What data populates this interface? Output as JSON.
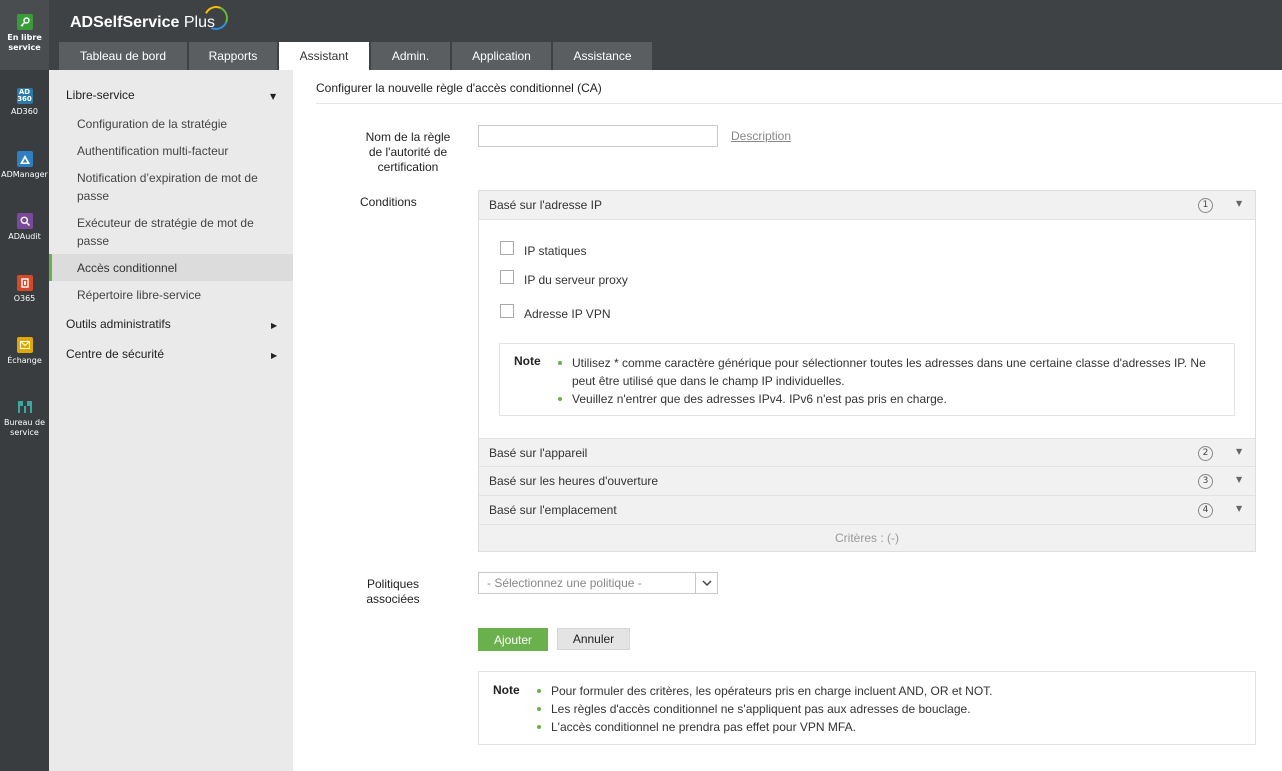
{
  "rail": [
    {
      "label": "En libre service",
      "icon": "key-icon",
      "color": "#3a9b3a"
    },
    {
      "label": "AD360",
      "icon": "ad360-icon",
      "color": "#2b7aa8"
    },
    {
      "label": "ADManager",
      "icon": "admanager-icon",
      "color": "#2d7fc1"
    },
    {
      "label": "ADAudit",
      "icon": "adaudit-icon",
      "color": "#7a4a9a"
    },
    {
      "label": "O365",
      "icon": "o365-icon",
      "color": "#d64a2a"
    },
    {
      "label": "Échange",
      "icon": "exchange-icon",
      "color": "#e0a800"
    },
    {
      "label": "Bureau de service",
      "icon": "servicedesk-icon",
      "color": "#3aa8a0"
    }
  ],
  "header": {
    "brand": "ADSelfService",
    "brand_plus": "Plus",
    "tabs": [
      "Tableau de bord",
      "Rapports",
      "Assistant",
      "Admin.",
      "Application",
      "Assistance"
    ],
    "active_tab": "Assistant"
  },
  "sidebar": {
    "group1": "Libre-service",
    "items": [
      "Configuration de la stratégie",
      "Authentification multi-facteur",
      "Notification d’expiration de mot de passe",
      "Exécuteur de stratégie de mot de passe",
      "Accès conditionnel",
      "Répertoire libre-service"
    ],
    "active_item": "Accès conditionnel",
    "group2": "Outils administratifs",
    "group3": "Centre de sécurité"
  },
  "main": {
    "title": "Configurer la nouvelle règle d'accès conditionnel (CA)",
    "rule_name_label": "Nom de la règle de l'autorité de certification",
    "rule_name_value": "",
    "description_link": "Description",
    "conditions_label": "Conditions",
    "accordion": [
      {
        "label": "Basé sur l'adresse IP",
        "num": "1"
      },
      {
        "label": "Basé sur l'appareil",
        "num": "2"
      },
      {
        "label": "Basé sur les heures d'ouverture",
        "num": "3"
      },
      {
        "label": "Basé sur l'emplacement",
        "num": "4"
      }
    ],
    "ip_options": [
      "IP statiques",
      "IP du serveur proxy",
      "Adresse IP VPN"
    ],
    "ip_note_title": "Note",
    "ip_notes": [
      "Utilisez * comme caractère générique pour sélectionner toutes les adresses dans une certaine classe d'adresses IP. Ne peut être utilisé que dans le champ IP individuelles.",
      "Veuillez n'entrer que des adresses IPv4. IPv6 n'est pas pris en charge."
    ],
    "criteria": "Critères : (-)",
    "policies_label": "Politiques associées",
    "policy_placeholder": "- Sélectionnez une politique -",
    "add_button": "Ajouter",
    "cancel_button": "Annuler",
    "bottom_note_title": "Note",
    "bottom_notes": [
      "Pour formuler des critères, les opérateurs pris en charge incluent AND, OR et NOT.",
      "Les règles d'accès conditionnel ne s'appliquent pas aux adresses de bouclage.",
      "L'accès conditionnel ne prendra pas effet pour VPN MFA."
    ]
  }
}
